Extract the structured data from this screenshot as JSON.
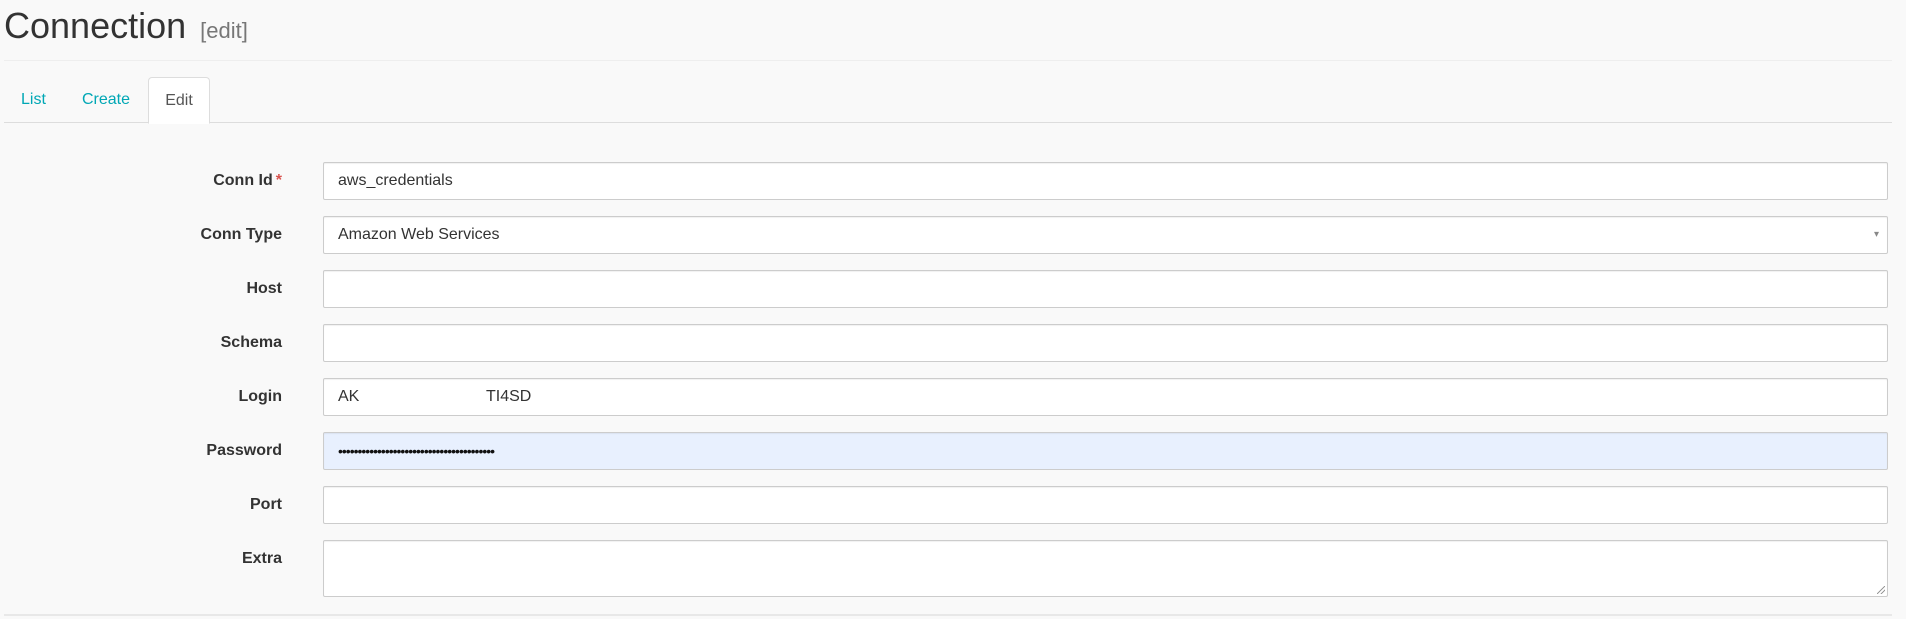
{
  "header": {
    "title": "Connection",
    "edit_tag": "[edit]"
  },
  "tabs": [
    {
      "label": "List",
      "active": false
    },
    {
      "label": "Create",
      "active": false
    },
    {
      "label": "Edit",
      "active": true
    }
  ],
  "form": {
    "conn_id": {
      "label": "Conn Id",
      "required_mark": "*",
      "value": "aws_credentials"
    },
    "conn_type": {
      "label": "Conn Type",
      "value": "Amazon Web Services",
      "arrow": "▾"
    },
    "host": {
      "label": "Host",
      "value": ""
    },
    "schema": {
      "label": "Schema",
      "value": ""
    },
    "login": {
      "label": "Login",
      "value_prefix": "AK",
      "value_suffix": "TI4SD"
    },
    "password": {
      "label": "Password",
      "value": "••••••••••••••••••••••••••••••••••••••••"
    },
    "port": {
      "label": "Port",
      "value": ""
    },
    "extra": {
      "label": "Extra",
      "value": ""
    }
  },
  "colors": {
    "link": "#00a7b5",
    "required": "#d9534f",
    "autofill_bg": "#e8f0fe",
    "page_bg": "#f9f9f9"
  }
}
